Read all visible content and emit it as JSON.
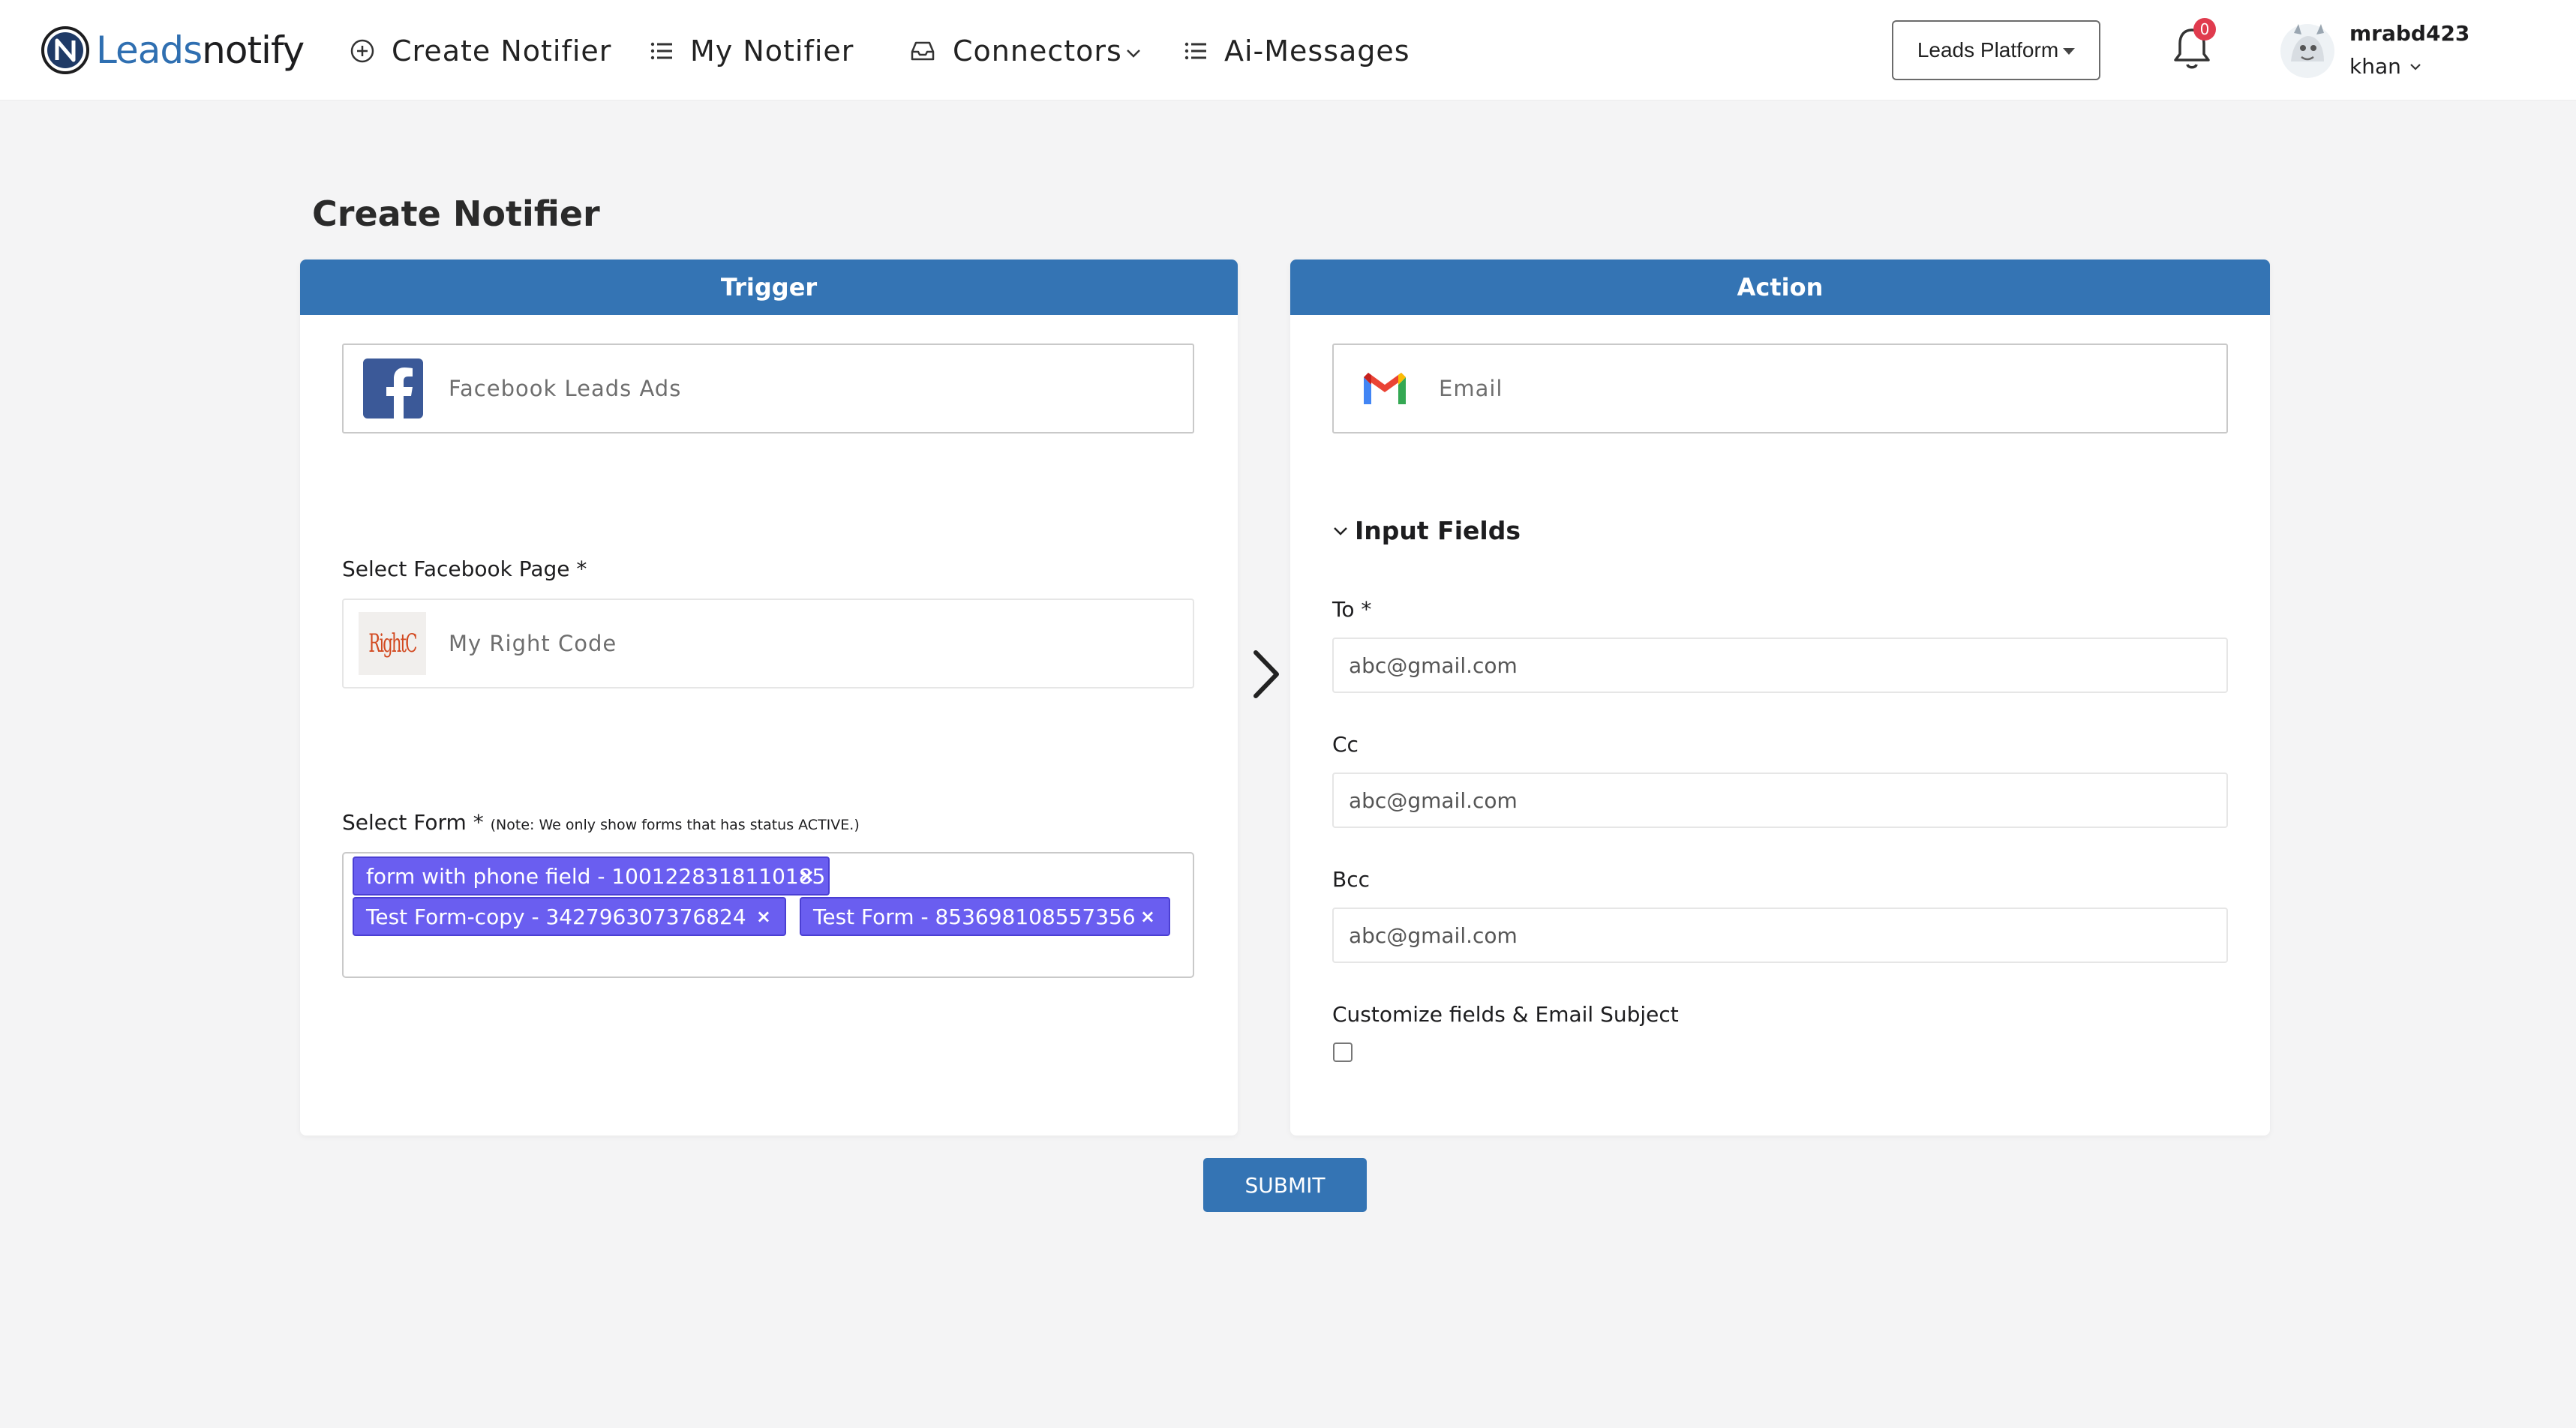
{
  "brand": {
    "name_part1": "Leads",
    "name_part2": "notify"
  },
  "nav": {
    "create_notifier": "Create Notifier",
    "my_notifier": "My Notifier",
    "connectors": "Connectors",
    "ai_messages": "Ai-Messages"
  },
  "platform_select": {
    "selected": "Leads Platform"
  },
  "notifications": {
    "count": "0"
  },
  "user": {
    "username": "mrabd423",
    "secondary": "khan"
  },
  "page": {
    "title": "Create Notifier"
  },
  "trigger": {
    "header": "Trigger",
    "app_name": "Facebook Leads Ads",
    "page_label": "Select Facebook Page *",
    "page_logo_text": "RightC",
    "page_value": "My Right Code",
    "form_label": "Select Form *",
    "form_note": "(Note: We only show forms that has status ACTIVE.)",
    "selected_forms": [
      "form with phone field - 1001228318110185",
      "Test Form-copy - 342796307376824",
      "Test Form - 853698108557356"
    ],
    "chip_remove": "×"
  },
  "action": {
    "header": "Action",
    "app_name": "Email",
    "section_title": "Input Fields",
    "to_label": "To *",
    "to_placeholder": "abc@gmail.com",
    "cc_label": "Cc",
    "cc_placeholder": "abc@gmail.com",
    "bcc_label": "Bcc",
    "bcc_placeholder": "abc@gmail.com",
    "customize_label": "Customize fields & Email Subject",
    "customize_checked": false
  },
  "submit_label": "SUBMIT",
  "colors": {
    "primary": "#3474b4",
    "chip": "#6a5ef0",
    "badge": "#e03b4e",
    "facebook": "#3b5998",
    "brand_blue": "#2f6fb1"
  },
  "icons": {
    "create": "plus-circle-icon",
    "list": "list-icon",
    "connectors": "inbox-icon",
    "notifications": "bell-icon",
    "facebook": "facebook-icon",
    "gmail": "gmail-icon"
  }
}
